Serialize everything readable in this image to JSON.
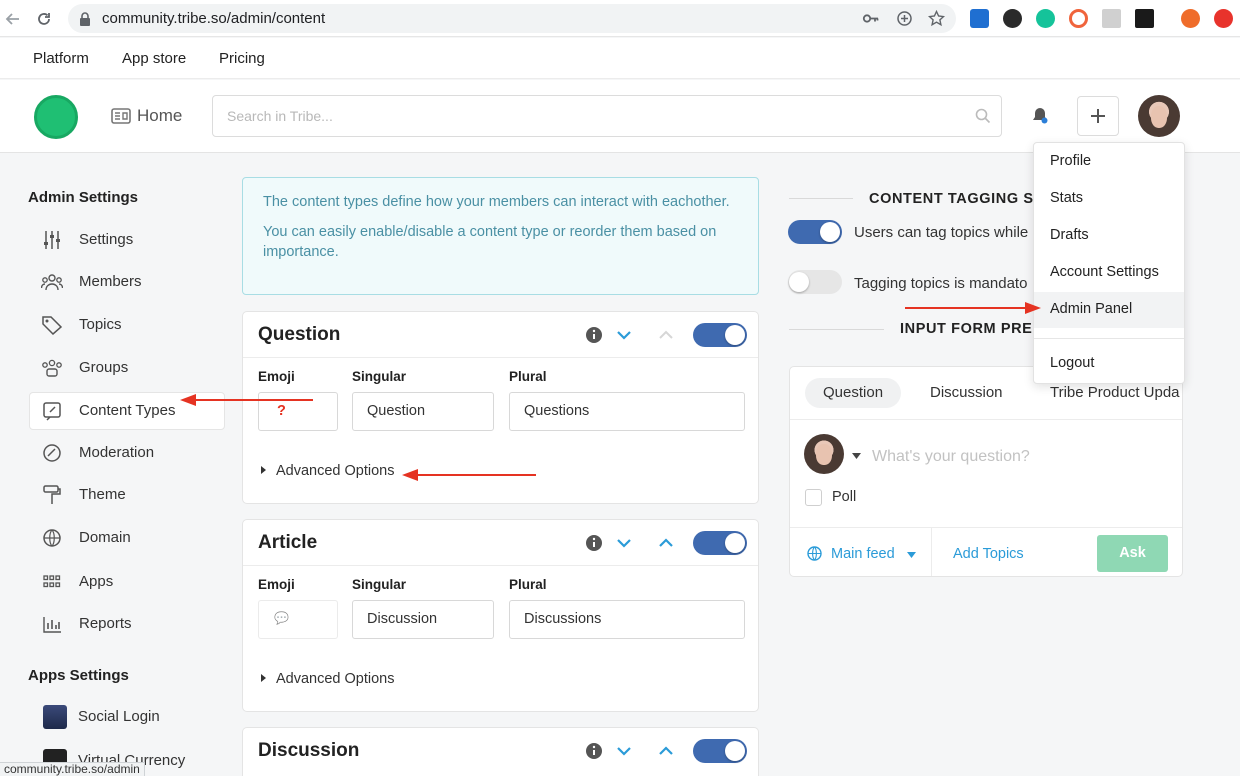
{
  "browser": {
    "url": "community.tribe.so/admin/content",
    "status_url": "community.tribe.so/admin"
  },
  "site_nav": [
    "Platform",
    "App store",
    "Pricing"
  ],
  "header": {
    "home_label": "Home",
    "search_placeholder": "Search in Tribe..."
  },
  "sidebar": {
    "admin_heading": "Admin Settings",
    "items": [
      {
        "label": "Settings",
        "icon": "sliders-icon"
      },
      {
        "label": "Members",
        "icon": "members-icon"
      },
      {
        "label": "Topics",
        "icon": "tag-icon"
      },
      {
        "label": "Groups",
        "icon": "groups-icon"
      },
      {
        "label": "Content Types",
        "icon": "content-types-icon"
      },
      {
        "label": "Moderation",
        "icon": "moderation-icon"
      },
      {
        "label": "Theme",
        "icon": "paint-roller-icon"
      },
      {
        "label": "Domain",
        "icon": "globe-icon"
      },
      {
        "label": "Apps",
        "icon": "apps-grid-icon"
      },
      {
        "label": "Reports",
        "icon": "bar-chart-icon"
      }
    ],
    "apps_heading": "Apps Settings",
    "app_items": [
      {
        "label": "Social Login"
      },
      {
        "label": "Virtual Currency"
      }
    ]
  },
  "info": {
    "line1": "The content types define how your members can interact with eachother.",
    "line2": "You can easily enable/disable a content type or reorder them based on importance."
  },
  "labels": {
    "emoji": "Emoji",
    "singular": "Singular",
    "plural": "Plural",
    "advanced": "Advanced Options"
  },
  "content_types": [
    {
      "title": "Question",
      "emoji": "?",
      "singular": "Question",
      "plural": "Questions",
      "enabled": true
    },
    {
      "title": "Article",
      "emoji": "💬",
      "singular": "Discussion",
      "plural": "Discussions",
      "enabled": true
    },
    {
      "title": "Discussion",
      "enabled": true
    }
  ],
  "tagging": {
    "title": "CONTENT TAGGING S",
    "opt1": "Users can tag topics while",
    "opt1_on": true,
    "opt2": "Tagging topics is mandato",
    "opt2_on": false
  },
  "preview": {
    "title": "INPUT FORM PRE",
    "tabs": [
      "Question",
      "Discussion",
      "Tribe Product Upda"
    ],
    "placeholder": "What's your question?",
    "poll": "Poll",
    "feed": "Main feed",
    "add_topics": "Add Topics",
    "ask": "Ask"
  },
  "dropdown": [
    "Profile",
    "Stats",
    "Drafts",
    "Account Settings",
    "Admin Panel",
    "Logout"
  ],
  "colors": {
    "accent": "#2b9bd8",
    "toggle_on": "#3f6ab0",
    "brand_green": "#1fbf73",
    "arrow": "#e53322"
  }
}
